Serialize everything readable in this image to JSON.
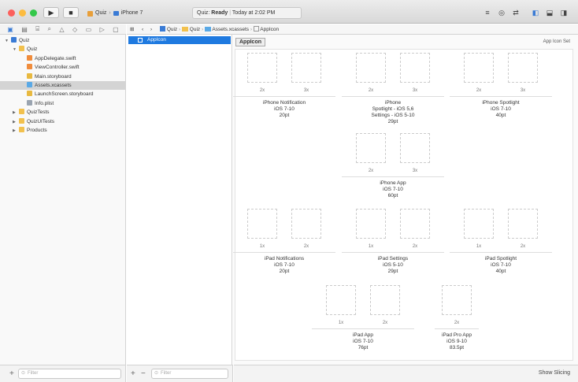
{
  "window": {
    "scheme_app": "Quiz",
    "scheme_device": "iPhone 7",
    "status_app": "Quiz:",
    "status_state": "Ready",
    "status_time": "Today at 2:02 PM"
  },
  "navigator": {
    "items": [
      {
        "label": "Quiz",
        "depth": 0,
        "expanded": true,
        "kind": "project",
        "selected": false
      },
      {
        "label": "Quiz",
        "depth": 1,
        "expanded": true,
        "kind": "folder",
        "selected": false
      },
      {
        "label": "AppDelegate.swift",
        "depth": 2,
        "kind": "swift",
        "selected": false
      },
      {
        "label": "ViewController.swift",
        "depth": 2,
        "kind": "swift",
        "selected": false
      },
      {
        "label": "Main.storyboard",
        "depth": 2,
        "kind": "storyboard",
        "selected": false
      },
      {
        "label": "Assets.xcassets",
        "depth": 2,
        "kind": "assets",
        "selected": true
      },
      {
        "label": "LaunchScreen.storyboard",
        "depth": 2,
        "kind": "storyboard",
        "selected": false
      },
      {
        "label": "Info.plist",
        "depth": 2,
        "kind": "plist",
        "selected": false
      },
      {
        "label": "QuizTests",
        "depth": 1,
        "expanded": false,
        "kind": "folder",
        "selected": false
      },
      {
        "label": "QuizUITests",
        "depth": 1,
        "expanded": false,
        "kind": "folder",
        "selected": false
      },
      {
        "label": "Products",
        "depth": 1,
        "expanded": false,
        "kind": "folder",
        "selected": false
      }
    ],
    "filter_placeholder": "Filter"
  },
  "jumpbar": {
    "crumbs": [
      "Quiz",
      "Quiz",
      "Assets.xcassets",
      "AppIcon"
    ]
  },
  "asset_list": {
    "items": [
      "AppIcon"
    ],
    "filter_placeholder": "Filter"
  },
  "editor": {
    "set_name": "AppIcon",
    "set_type": "App Icon Set",
    "footer_action": "Show Slicing",
    "groups": [
      {
        "label": "iPhone Notification\niOS 7-10\n20pt",
        "scales": [
          "2x",
          "3x"
        ]
      },
      {
        "label": "iPhone\nSpotlight - iOS 5,6\nSettings - iOS 5-10\n29pt",
        "scales": [
          "2x",
          "3x"
        ]
      },
      {
        "label": "iPhone Spotlight\niOS 7-10\n40pt",
        "scales": [
          "2x",
          "3x"
        ]
      },
      {
        "label": "iPhone App\niOS 7-10\n60pt",
        "scales": [
          "2x",
          "3x"
        ]
      },
      {
        "label": "iPad Notifications\niOS 7-10\n20pt",
        "scales": [
          "1x",
          "2x"
        ]
      },
      {
        "label": "iPad Settings\niOS 5-10\n29pt",
        "scales": [
          "1x",
          "2x"
        ]
      },
      {
        "label": "iPad Spotlight\niOS 7-10\n40pt",
        "scales": [
          "1x",
          "2x"
        ]
      },
      {
        "label": "iPad App\niOS 7-10\n76pt",
        "scales": [
          "1x",
          "2x"
        ]
      },
      {
        "label": "iPad Pro App\niOS 9-10\n83.5pt",
        "scales": [
          "2x"
        ]
      }
    ]
  },
  "colors": {
    "selection": "#1f7ae0",
    "folder": "#f2c14e",
    "close": "#fc605c",
    "minimize": "#fdbc40",
    "zoom": "#34c84a"
  }
}
